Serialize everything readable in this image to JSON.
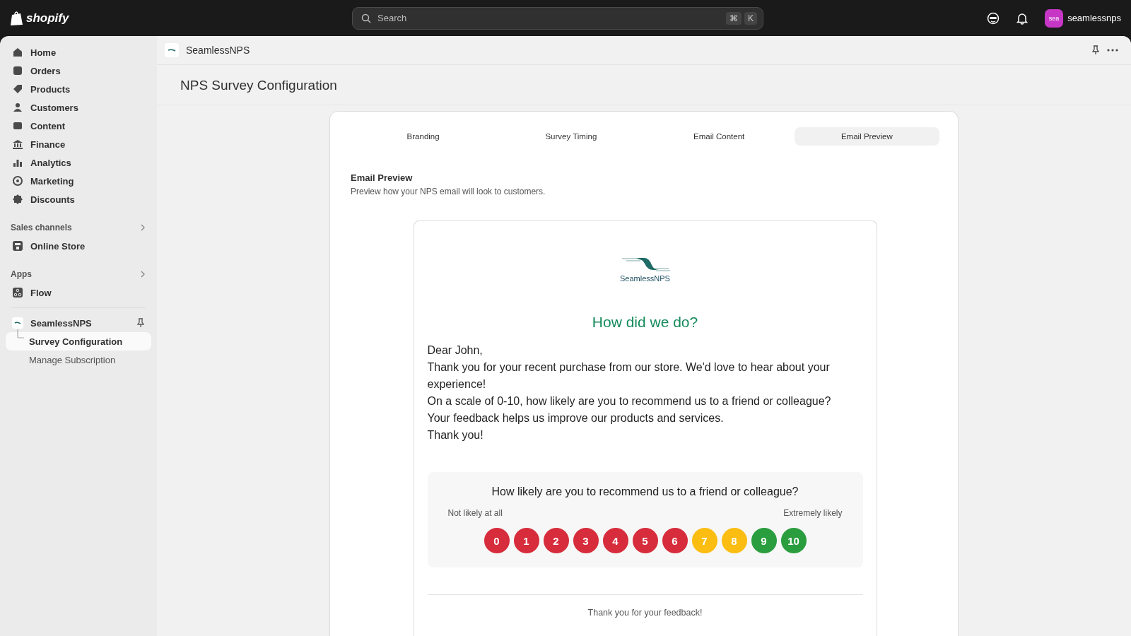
{
  "topbar": {
    "brand": "shopify",
    "search": {
      "placeholder": "Search",
      "keys": [
        "⌘",
        "K"
      ]
    },
    "account": {
      "avatar": "sea",
      "name": "seamlessnps"
    }
  },
  "sidebar": {
    "nav": [
      {
        "label": "Home",
        "selected": false
      },
      {
        "label": "Orders",
        "selected": false
      },
      {
        "label": "Products",
        "selected": false
      },
      {
        "label": "Customers",
        "selected": false
      },
      {
        "label": "Content",
        "selected": false
      },
      {
        "label": "Finance",
        "selected": false
      },
      {
        "label": "Analytics",
        "selected": false
      },
      {
        "label": "Marketing",
        "selected": false
      },
      {
        "label": "Discounts",
        "selected": false
      }
    ],
    "sales_channels": {
      "title": "Sales channels",
      "items": [
        {
          "label": "Online Store",
          "selected": false
        }
      ]
    },
    "apps": {
      "title": "Apps",
      "items": [
        {
          "label": "Flow",
          "selected": false
        }
      ]
    },
    "app": {
      "name": "SeamlessNPS",
      "children": [
        {
          "label": "Survey Configuration",
          "selected": true
        },
        {
          "label": "Manage Subscription",
          "selected": false
        }
      ]
    }
  },
  "app_header": {
    "title": "SeamlessNPS"
  },
  "page": {
    "title": "NPS Survey Configuration",
    "tabs": [
      {
        "label": "Branding",
        "selected": false
      },
      {
        "label": "Survey Timing",
        "selected": false
      },
      {
        "label": "Email Content",
        "selected": false
      },
      {
        "label": "Email Preview",
        "selected": true
      }
    ],
    "section": {
      "title": "Email Preview",
      "description": "Preview how your NPS email will look to customers."
    },
    "email": {
      "logo_text": "SeamlessNPS",
      "heading": "How did we do?",
      "body": [
        "Dear John,",
        "Thank you for your recent purchase from our store. We'd love to hear about your experience!",
        "On a scale of 0-10, how likely are you to recommend us to a friend or colleague?",
        "Your feedback helps us improve our products and services.",
        "Thank you!"
      ],
      "survey": {
        "question": "How likely are you to recommend us to a friend or colleague?",
        "low_label": "Not likely at all",
        "high_label": "Extremely likely",
        "scores": [
          {
            "label": "0",
            "color": "#d72c3c"
          },
          {
            "label": "1",
            "color": "#d72c3c"
          },
          {
            "label": "2",
            "color": "#d72c3c"
          },
          {
            "label": "3",
            "color": "#d72c3c"
          },
          {
            "label": "4",
            "color": "#d72c3c"
          },
          {
            "label": "5",
            "color": "#d72c3c"
          },
          {
            "label": "6",
            "color": "#d72c3c"
          },
          {
            "label": "7",
            "color": "#fbbd12"
          },
          {
            "label": "8",
            "color": "#fbbd12"
          },
          {
            "label": "9",
            "color": "#2a9d3f"
          },
          {
            "label": "10",
            "color": "#2a9d3f"
          }
        ]
      },
      "footer": "Thank you for your feedback!"
    }
  }
}
